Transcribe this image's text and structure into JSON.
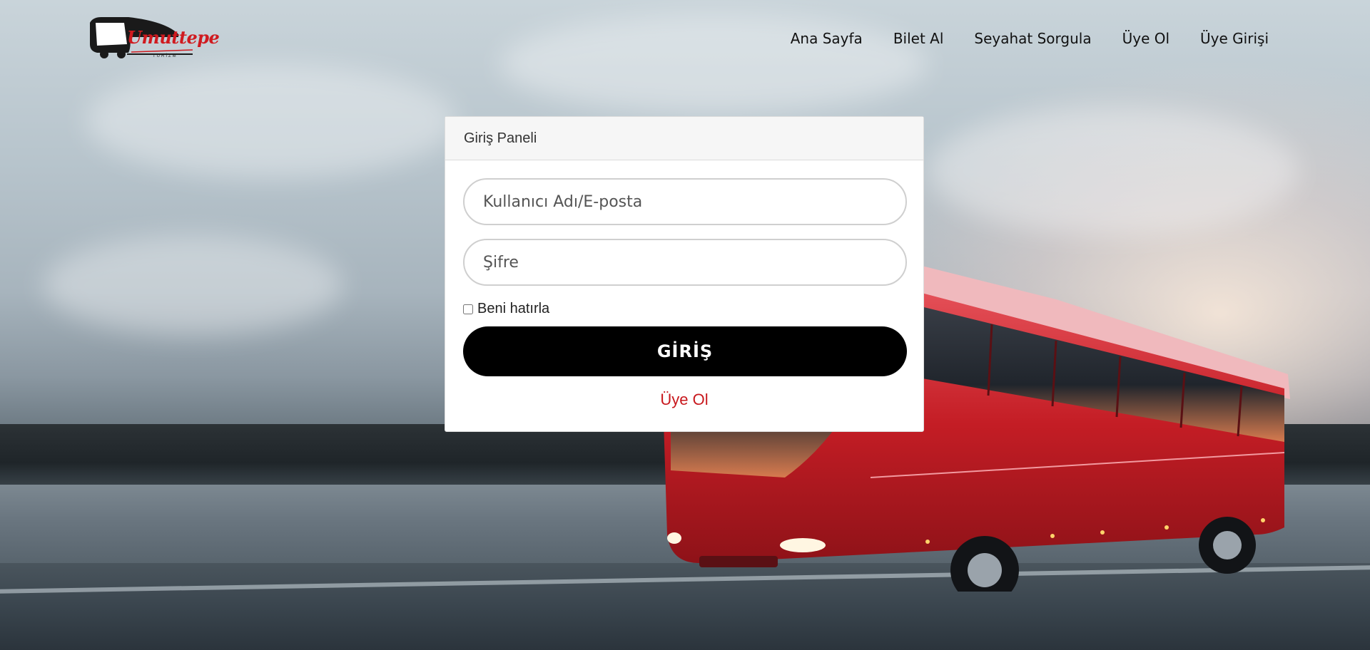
{
  "brand": {
    "logo_text": "Umuttepe",
    "logo_subtext": "TURİZM",
    "accent_color": "#d01a1f"
  },
  "nav": {
    "items": [
      {
        "label": "Ana Sayfa"
      },
      {
        "label": "Bilet Al"
      },
      {
        "label": "Seyahat Sorgula"
      },
      {
        "label": "Üye Ol"
      },
      {
        "label": "Üye Girişi"
      }
    ]
  },
  "login_panel": {
    "title": "Giriş Paneli",
    "username_placeholder": "Kullanıcı Adı/E-posta",
    "username_value": "",
    "password_placeholder": "Şifre",
    "password_value": "",
    "remember_label": "Beni hatırla",
    "remember_checked": false,
    "submit_label": "GİRİŞ",
    "register_link_label": "Üye Ol",
    "button_color": "#000000",
    "link_color": "#c8181d"
  },
  "background": {
    "subject": "red coach bus on road by lake at sunset"
  }
}
